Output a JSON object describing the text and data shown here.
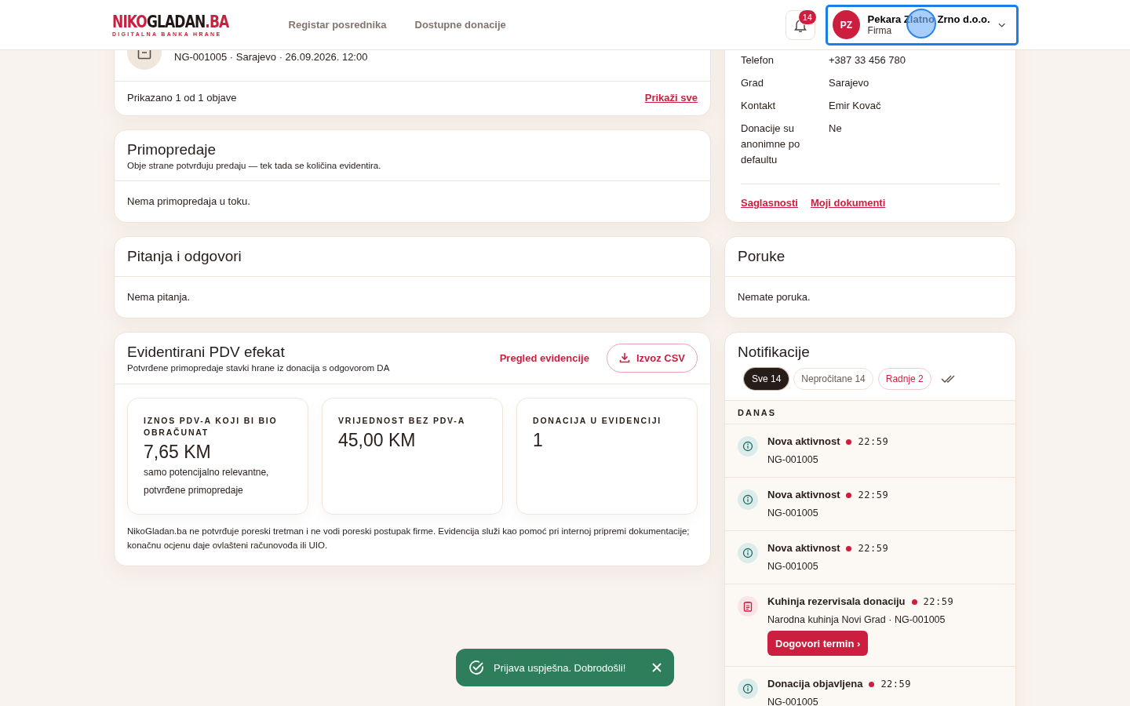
{
  "header": {
    "logo": {
      "part_1": "NIKO",
      "part_2": "GLADAN",
      "part_3": ".BA",
      "tagline": "DIGITALNA BANKA HRANE"
    },
    "nav": [
      "Registar posrednika",
      "Dostupne donacije"
    ],
    "notifications_badge": "14",
    "user": {
      "initials": "PZ",
      "name": "Pekara Zlatno Zrno d.o.o.",
      "role": "Firma",
      "focused": true
    }
  },
  "listings": {
    "items": [
      {
        "meta": "NG-001005 · Sarajevo · 26.09.2026. 12:00"
      }
    ],
    "summary": "Prikazano 1 od 1 objave",
    "link": "Prikaži sve"
  },
  "handovers": {
    "title": "Primopredaje",
    "subtitle": "Obje strane potvrđuju predaju — tek tada se količina evidentira.",
    "empty": "Nema primopredaja u toku."
  },
  "questions": {
    "title": "Pitanja i odgovori",
    "empty": "Nema pitanja."
  },
  "vat": {
    "title": "Evidentirani PDV efekat",
    "subtitle": "Potvrđene primopredaje stavki hrane iz donacija s odgovorom DA",
    "link": "Pregled evidencije",
    "button": "Izvoz CSV",
    "stats": [
      {
        "label": "IZNOS PDV-A KOJI BI BIO OBRAČUNAT",
        "value": "7,65 KM",
        "note": "samo potencijalno relevantne, potvrđene primopredaje"
      },
      {
        "label": "VRIJEDNOST BEZ PDV-A",
        "value": "45,00 KM"
      },
      {
        "label": "DONACIJA U EVIDENCIJI",
        "value": "1"
      }
    ],
    "disclaimer": "NikoGladan.ba ne potvrđuje poreski tretman i ne vodi poreski postupak firme. Evidencija služi kao pomoć pri internoj pripremi dokumentacije; konačnu ocjenu daje ovlašteni računovođa ili UIO."
  },
  "profile": {
    "rows": [
      {
        "label": "Telefon",
        "value": "+387 33 456 780"
      },
      {
        "label": "Grad",
        "value": "Sarajevo"
      },
      {
        "label": "Kontakt",
        "value": "Emir Kovač"
      },
      {
        "label": "Donacije su anonimne po defaultu",
        "value": "Ne"
      }
    ],
    "links": [
      "Saglasnosti",
      "Moji dokumenti"
    ]
  },
  "messages": {
    "title": "Poruke",
    "empty": "Nemate poruka."
  },
  "notifications": {
    "title": "Notifikacije",
    "filters": [
      {
        "label": "Sve 14",
        "kind": "default",
        "selected": true
      },
      {
        "label": "Nepročitane 14",
        "kind": "default",
        "selected": false
      },
      {
        "label": "Radnje 2",
        "kind": "action",
        "selected": false
      }
    ],
    "groups": [
      {
        "label": "DANAS",
        "items": [
          {
            "kind": "info",
            "title": "Nova aktivnost",
            "unread": true,
            "time": "22:59",
            "detail": "NG-001005"
          },
          {
            "kind": "info",
            "title": "Nova aktivnost",
            "unread": true,
            "time": "22:59",
            "detail": "NG-001005"
          },
          {
            "kind": "info",
            "title": "Nova aktivnost",
            "unread": true,
            "time": "22:59",
            "detail": "NG-001005"
          },
          {
            "kind": "reservation",
            "title": "Kuhinja rezervisala donaciju",
            "unread": true,
            "time": "22:59",
            "detail": "Narodna kuhinja Novi Grad · NG-001005",
            "action": "Dogovori termin ›"
          },
          {
            "kind": "info",
            "title": "Donacija objavljena",
            "unread": true,
            "time": "22:59",
            "detail": "NG-001005"
          }
        ]
      }
    ]
  },
  "toast": {
    "text": "Prijava uspješna. Dobrodošli!"
  }
}
